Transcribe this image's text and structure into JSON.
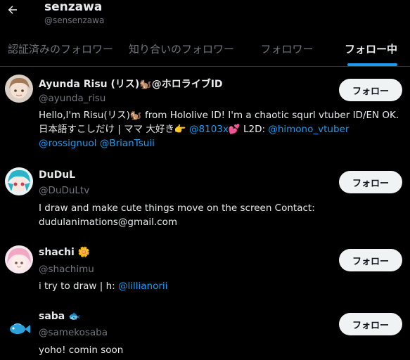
{
  "header": {
    "back_label": "Back",
    "name": "senzawa",
    "handle": "@sensenzawa"
  },
  "tabs": [
    {
      "label": "認証済みのフォロワー",
      "active": false
    },
    {
      "label": "知り合いのフォロワー",
      "active": false
    },
    {
      "label": "フォロワー",
      "active": false
    },
    {
      "label": "フォロー中",
      "active": true
    }
  ],
  "users": [
    {
      "name": "Ayunda Risu (リス)🐿️@ホロライブID",
      "handle": "@ayunda_risu",
      "bio_text_1": "Hello,I'm Risu(リス)🐿️ from Hololive ID! I'm a chaotic squrl vtuber ID/EN OK. 日本語すこしだけ | ママ 大好き👉 ",
      "bio_link_1": "@8103x",
      "bio_text_2": "💕  L2D: ",
      "bio_link_2": "@himono_vtuber",
      "bio_link_3": "@rossignuol",
      "bio_link_4": "@BrianTsuii",
      "follow_label": "フォロー"
    },
    {
      "name": "DuDuL",
      "handle": "@DuDuLtv",
      "bio_text_1": "I draw and make cute things move on the screen Contact: dudulanimations@gmail.com",
      "follow_label": "フォロー"
    },
    {
      "name": "shachi 🌼",
      "handle": "@shachimu",
      "bio_text_1": "i try to draw | h: ",
      "bio_link_1": "@lillianorii",
      "follow_label": "フォロー"
    },
    {
      "name": "saba 🐟",
      "handle": "@samekosaba",
      "bio_text_1": "yoho! comin soon",
      "follow_label": "フォロー"
    }
  ],
  "colors": {
    "background": "#000000",
    "text": "#e7e9ea",
    "muted": "#71767b",
    "link": "#1d9bf0",
    "button": "#eff3f4"
  }
}
